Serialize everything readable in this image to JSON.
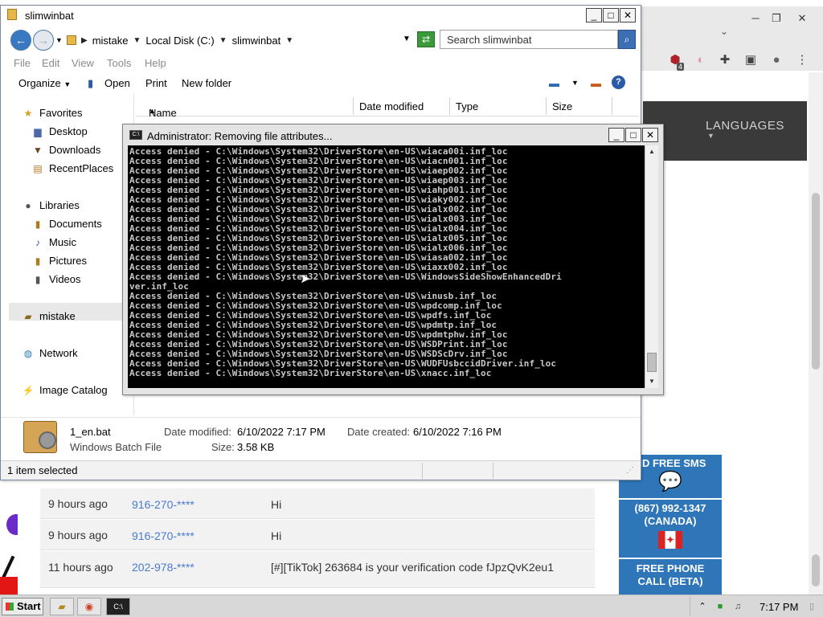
{
  "explorer": {
    "title": "slimwinbat",
    "breadcrumbs": [
      "mistake",
      "Local Disk (C:)",
      "slimwinbat"
    ],
    "search_placeholder": "Search slimwinbat",
    "menu": [
      "File",
      "Edit",
      "View",
      "Tools",
      "Help"
    ],
    "commands": {
      "organize": "Organize",
      "open": "Open",
      "print": "Print",
      "new_folder": "New folder"
    },
    "nav": {
      "favorites": "Favorites",
      "desktop": "Desktop",
      "downloads": "Downloads",
      "recent": "RecentPlaces",
      "libraries": "Libraries",
      "documents": "Documents",
      "music": "Music",
      "pictures": "Pictures",
      "videos": "Videos",
      "user": "mistake",
      "network": "Network",
      "image_catalog": "Image Catalog"
    },
    "columns": [
      "Name",
      "Date modified",
      "Type",
      "Size"
    ],
    "details": {
      "filename": "1_en.bat",
      "filetype": "Windows Batch File",
      "modified_label": "Date modified:",
      "modified": "6/10/2022 7:17 PM",
      "created_label": "Date created:",
      "created": "6/10/2022 7:16 PM",
      "size_label": "Size:",
      "size": "3.58 KB"
    },
    "status": "1 item selected"
  },
  "console": {
    "title": "Administrator:  Removing file attributes...",
    "lines": [
      "Access denied - C:\\Windows\\System32\\DriverStore\\en-US\\wiaca00i.inf_loc",
      "Access denied - C:\\Windows\\System32\\DriverStore\\en-US\\wiacn001.inf_loc",
      "Access denied - C:\\Windows\\System32\\DriverStore\\en-US\\wiaep002.inf_loc",
      "Access denied - C:\\Windows\\System32\\DriverStore\\en-US\\wiaep003.inf_loc",
      "Access denied - C:\\Windows\\System32\\DriverStore\\en-US\\wiahp001.inf_loc",
      "Access denied - C:\\Windows\\System32\\DriverStore\\en-US\\wiaky002.inf_loc",
      "Access denied - C:\\Windows\\System32\\DriverStore\\en-US\\wialx002.inf_loc",
      "Access denied - C:\\Windows\\System32\\DriverStore\\en-US\\wialx003.inf_loc",
      "Access denied - C:\\Windows\\System32\\DriverStore\\en-US\\wialx004.inf_loc",
      "Access denied - C:\\Windows\\System32\\DriverStore\\en-US\\wialx005.inf_loc",
      "Access denied - C:\\Windows\\System32\\DriverStore\\en-US\\wialx006.inf_loc",
      "Access denied - C:\\Windows\\System32\\DriverStore\\en-US\\wiasa002.inf_loc",
      "Access denied - C:\\Windows\\System32\\DriverStore\\en-US\\wiaxx002.inf_loc",
      "Access denied - C:\\Windows\\System32\\DriverStore\\en-US\\WindowsSideShowEnhancedDri",
      "ver.inf_loc",
      "Access denied - C:\\Windows\\System32\\DriverStore\\en-US\\winusb.inf_loc",
      "Access denied - C:\\Windows\\System32\\DriverStore\\en-US\\wpdcomp.inf_loc",
      "Access denied - C:\\Windows\\System32\\DriverStore\\en-US\\wpdfs.inf_loc",
      "Access denied - C:\\Windows\\System32\\DriverStore\\en-US\\wpdmtp.inf_loc",
      "Access denied - C:\\Windows\\System32\\DriverStore\\en-US\\wpdmtphw.inf_loc",
      "Access denied - C:\\Windows\\System32\\DriverStore\\en-US\\WSDPrint.inf_loc",
      "Access denied - C:\\Windows\\System32\\DriverStore\\en-US\\WSDScDrv.inf_loc",
      "Access denied - C:\\Windows\\System32\\DriverStore\\en-US\\WUDFUsbccidDriver.inf_loc",
      "Access denied - C:\\Windows\\System32\\DriverStore\\en-US\\xnacc.inf_loc"
    ]
  },
  "browser": {
    "nav_languages": "LANGUAGES",
    "extension_badge": "4",
    "messages": [
      {
        "time": "9 hours ago",
        "number": "916-270-****",
        "text": "Hi"
      },
      {
        "time": "9 hours ago",
        "number": "916-270-****",
        "text": "Hi"
      },
      {
        "time": "11 hours ago",
        "number": "202-978-****",
        "text": "[#][TikTok] 263684 is your verification code fJpzQvK2eu1"
      }
    ],
    "ad": {
      "send_sms": "ND FREE SMS",
      "phone": "(867) 992-1347",
      "country": "(CANADA)",
      "free_call_1": "FREE PHONE",
      "free_call_2": "CALL (BETA)"
    }
  },
  "taskbar": {
    "start": "Start",
    "clock": "7:17 PM"
  }
}
